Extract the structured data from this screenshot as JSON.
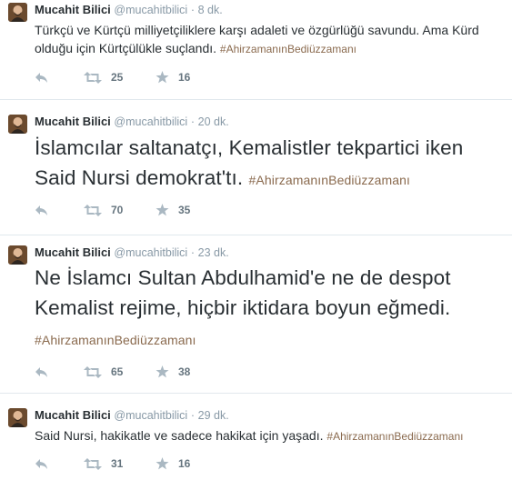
{
  "colors": {
    "hashtag": "#8a6a4e",
    "meta": "#8899a6",
    "icon": "#aab8c2",
    "count": "#66757f",
    "divider": "#e1e8ed"
  },
  "icons": {
    "reply": "reply-icon",
    "retweet": "retweet-icon",
    "favorite": "star-icon"
  },
  "tweets": [
    {
      "name": "Mucahit Bilici",
      "handle": "@mucahitbilici",
      "dot": "·",
      "time": "8 dk.",
      "text": "Türkçü ve Kürtçü milliyetçiliklere karşı adaleti ve özgürlüğü savundu. Ama Kürd olduğu için Kürtçülükle suçlandı.",
      "hashtag": "#AhirzamanınBediüzzamanı",
      "retweets": "25",
      "favorites": "16"
    },
    {
      "name": "Mucahit Bilici",
      "handle": "@mucahitbilici",
      "dot": "·",
      "time": "20 dk.",
      "text": "İslamcılar saltanatçı, Kemalistler tekpartici iken Said Nursi demokrat'tı.",
      "hashtag": "#AhirzamanınBediüzzamanı",
      "retweets": "70",
      "favorites": "35"
    },
    {
      "name": "Mucahit Bilici",
      "handle": "@mucahitbilici",
      "dot": "·",
      "time": "23 dk.",
      "text": "Ne İslamcı Sultan Abdulhamid'e ne de despot Kemalist rejime, hiçbir iktidara boyun eğmedi.",
      "hashtag": "#AhirzamanınBediüzzamanı",
      "retweets": "65",
      "favorites": "38"
    },
    {
      "name": "Mucahit Bilici",
      "handle": "@mucahitbilici",
      "dot": "·",
      "time": "29 dk.",
      "text": "Said Nursi, hakikatle ve sadece hakikat için yaşadı.",
      "hashtag": "#AhirzamanınBediüzzamanı",
      "retweets": "31",
      "favorites": "16"
    }
  ]
}
